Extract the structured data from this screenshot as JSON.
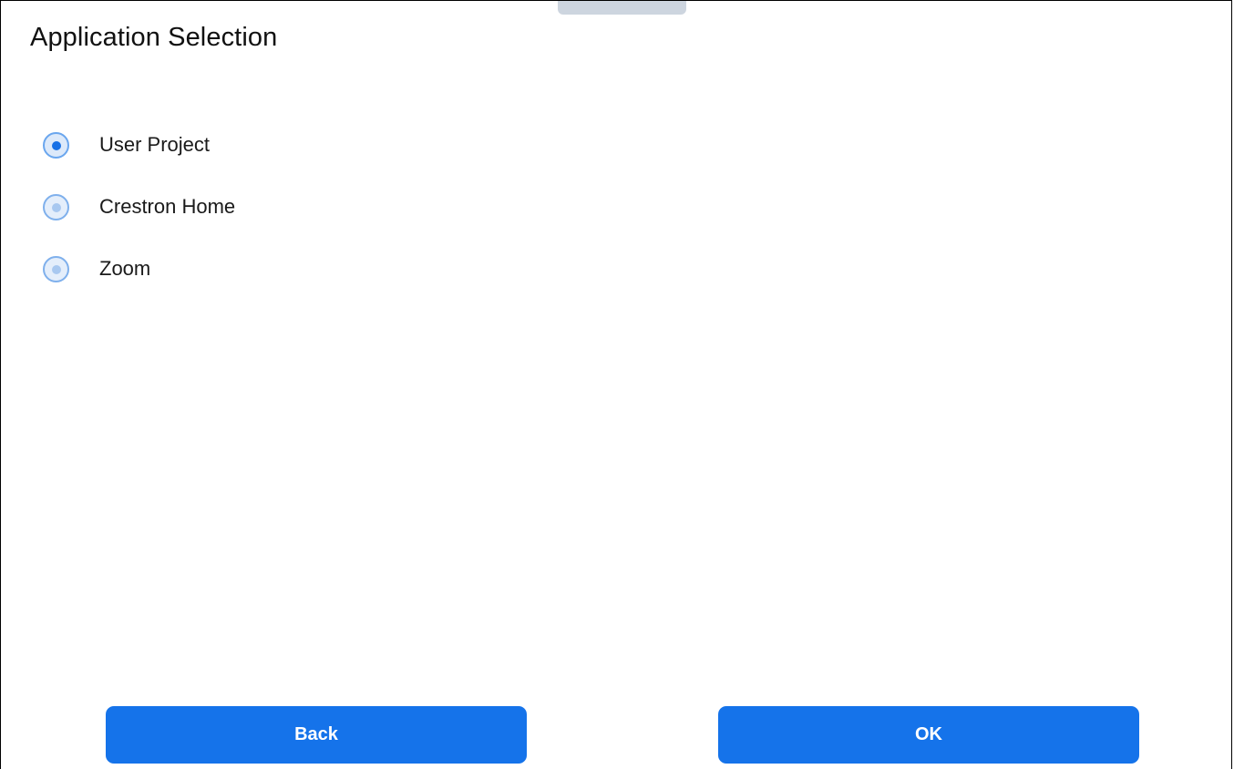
{
  "dialog": {
    "title": "Application Selection"
  },
  "options": [
    {
      "label": "User Project",
      "selected": true
    },
    {
      "label": "Crestron Home",
      "selected": false
    },
    {
      "label": "Zoom",
      "selected": false
    }
  ],
  "buttons": {
    "back_label": "Back",
    "ok_label": "OK"
  },
  "colors": {
    "accent": "#1573ea",
    "radio_border": "#7fb0ec",
    "handle": "#cdd5df"
  }
}
